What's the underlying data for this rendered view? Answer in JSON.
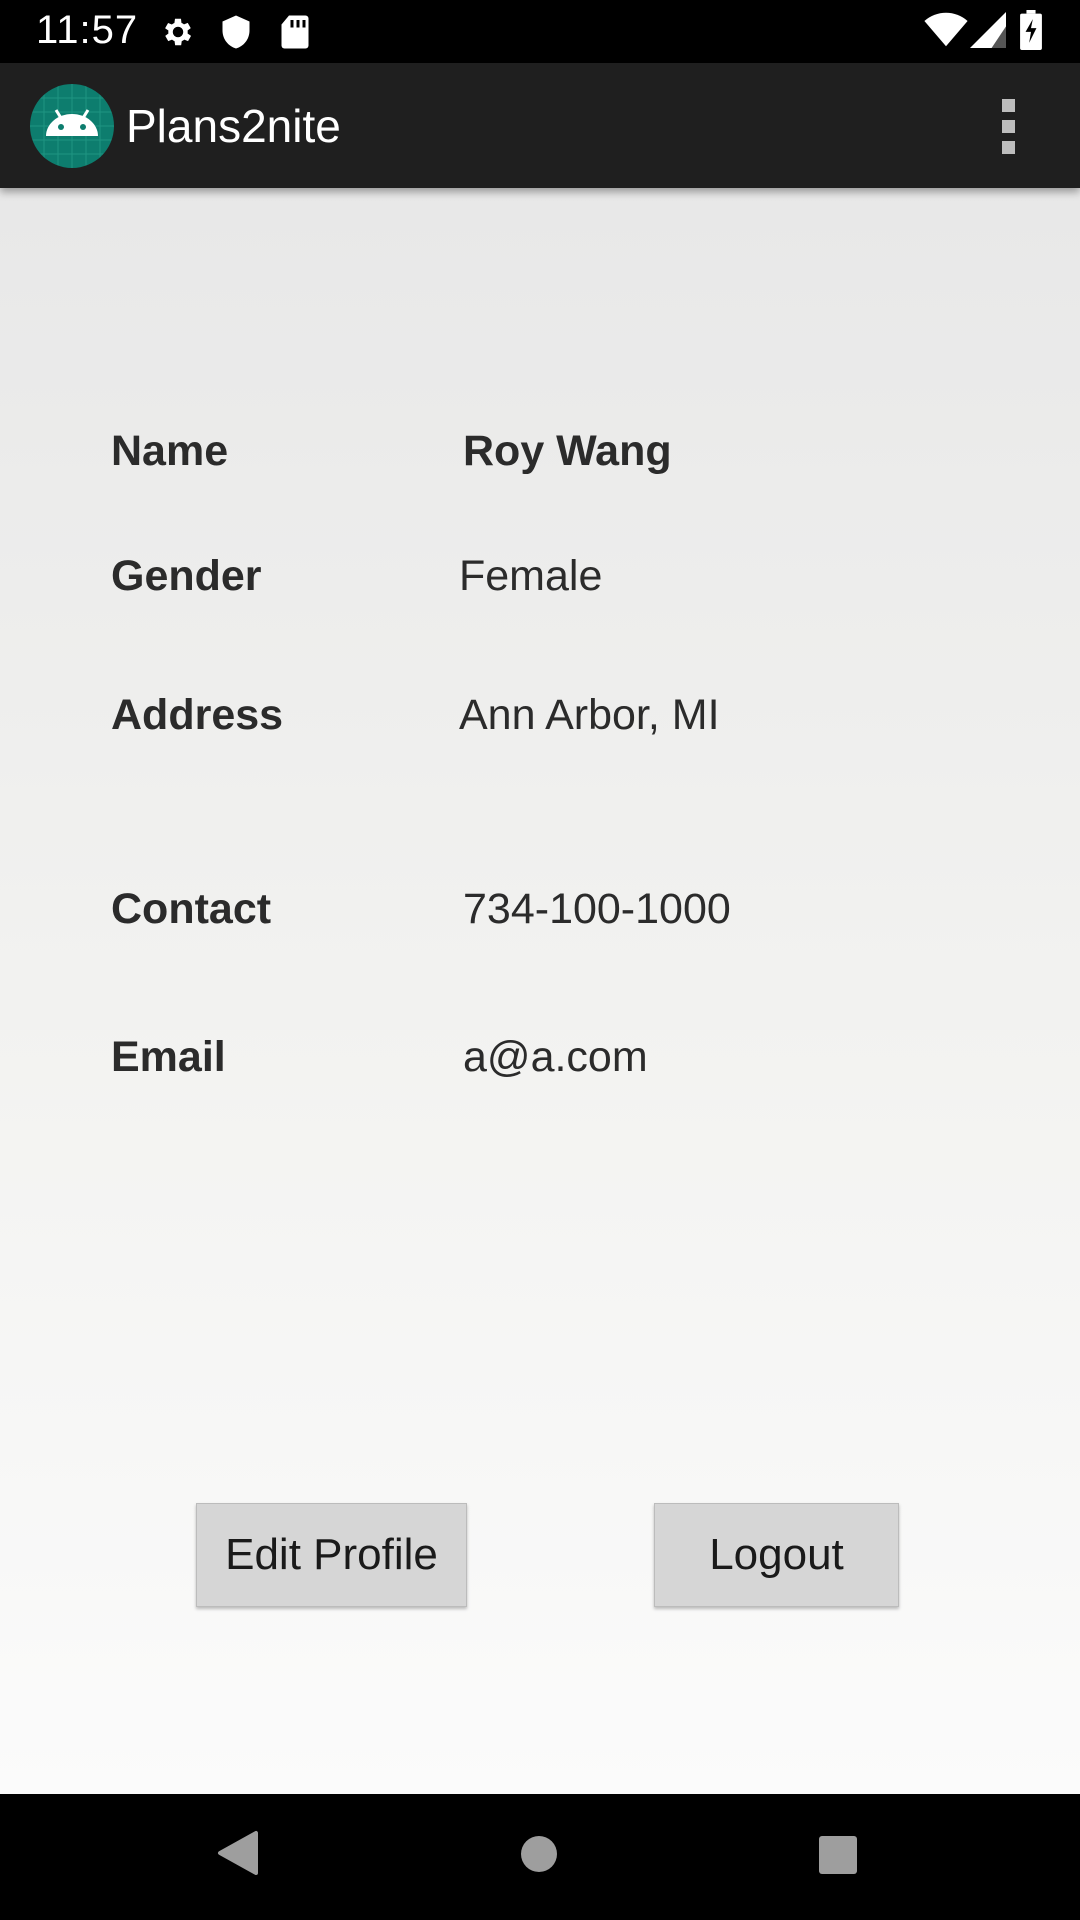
{
  "status_bar": {
    "time": "11:57",
    "icons": [
      "gear-icon",
      "shield-icon",
      "sd-card-icon",
      "wifi-icon",
      "signal-icon",
      "battery-charging-icon"
    ]
  },
  "app_bar": {
    "title": "Plans2nite",
    "logo_icon": "android-icon",
    "menu_icon": "overflow-menu-icon"
  },
  "profile": {
    "rows": [
      {
        "label": "Name",
        "value": "Roy Wang"
      },
      {
        "label": "Gender",
        "value": "Female"
      },
      {
        "label": "Address",
        "value": "Ann Arbor, MI"
      },
      {
        "label": "Contact",
        "value": "734-100-1000"
      },
      {
        "label": "Email",
        "value": "a@a.com"
      }
    ]
  },
  "actions": {
    "edit_label": "Edit Profile",
    "logout_label": "Logout"
  },
  "nav_bar": {
    "icons": [
      "back-icon",
      "home-icon",
      "recents-icon"
    ]
  },
  "colors": {
    "app_bar": "#1f1f1f",
    "logo_bg": "#0d7d6e",
    "button_bg": "#d6d6d6",
    "text": "#2b2b2b"
  }
}
